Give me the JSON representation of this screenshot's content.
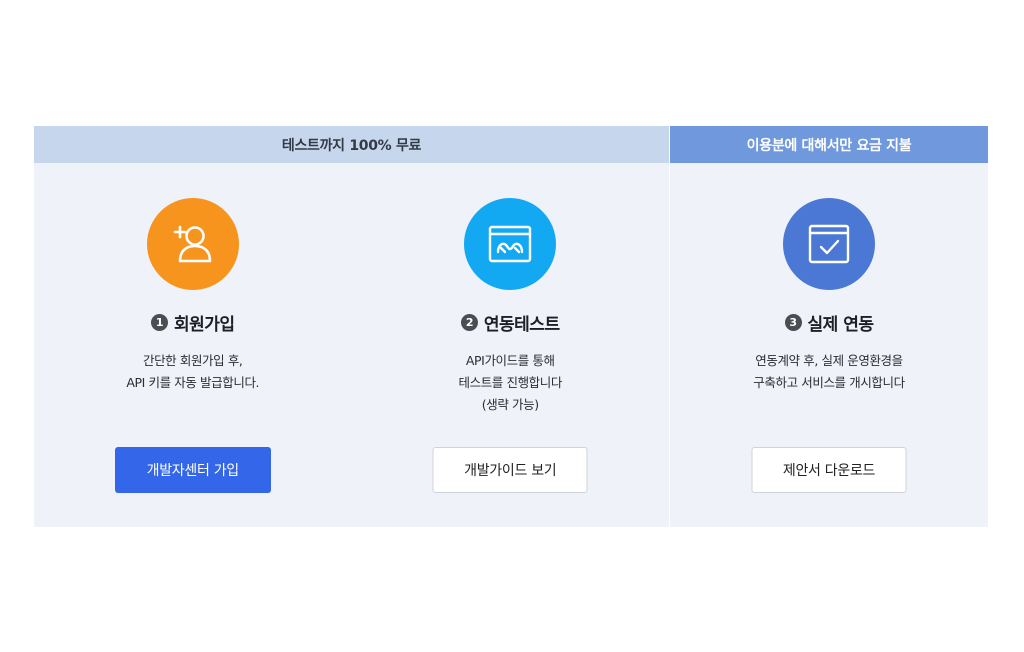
{
  "groups": {
    "free": {
      "header": "테스트까지 100% 무료"
    },
    "paid": {
      "header": "이용분에 대해서만 요금 지불"
    }
  },
  "steps": [
    {
      "number": "1",
      "title": "회원가입",
      "icon": "add-user-icon",
      "icon_color": "#f6941d",
      "desc": [
        "간단한 회원가입 후,",
        "API 키를 자동 발급합니다."
      ],
      "button": {
        "label": "개발자센터 가입",
        "style": "primary"
      }
    },
    {
      "number": "2",
      "title": "연동테스트",
      "icon": "browser-link-icon",
      "icon_color": "#12a9f2",
      "desc": [
        "API가이드를 통해",
        "테스트를 진행합니다",
        "(생략 가능)"
      ],
      "button": {
        "label": "개발가이드 보기",
        "style": "outline"
      }
    },
    {
      "number": "3",
      "title": "실제 연동",
      "icon": "checkbox-window-icon",
      "icon_color": "#4a78d4",
      "desc": [
        "연동계약 후, 실제 운영환경을",
        "구축하고 서비스를 개시합니다"
      ],
      "button": {
        "label": "제안서 다운로드",
        "style": "outline"
      }
    }
  ],
  "colors": {
    "free_header_bg": "#c6d6ec",
    "paid_header_bg": "#7098dd",
    "panel_bg": "#eff2f8",
    "primary_button": "#3366e8"
  }
}
